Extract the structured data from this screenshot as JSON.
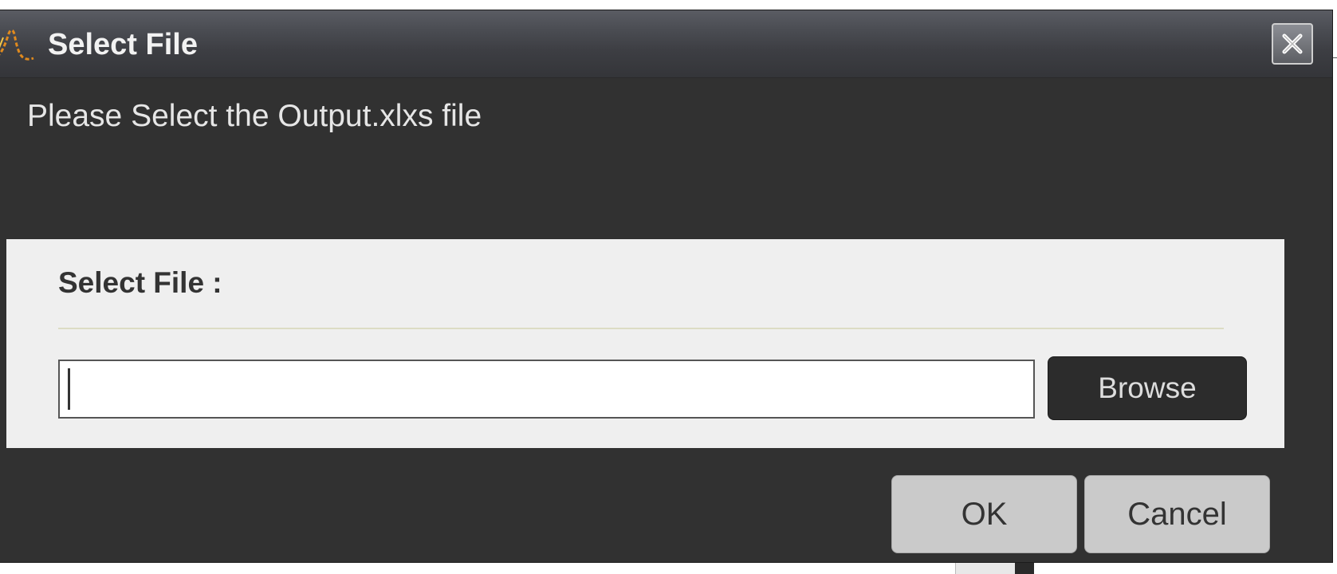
{
  "dialog": {
    "title": "Select File",
    "close_label": "close",
    "message": "Please Select the Output.xlxs file"
  },
  "panel": {
    "label": "Select File :",
    "file_input": {
      "value": "",
      "placeholder": ""
    },
    "browse_label": "Browse"
  },
  "buttons": {
    "ok_label": "OK",
    "cancel_label": "Cancel"
  },
  "icons": {
    "title_icon": "app-logo-icon",
    "close_icon": "close-icon"
  },
  "colors": {
    "dialog_bg": "#313131",
    "panel_bg": "#efefef",
    "title_text": "#f2f2f2",
    "browse_bg": "#2c2c2c",
    "action_button_bg": "#cacaca",
    "icon_accent": "#e08a1e"
  }
}
